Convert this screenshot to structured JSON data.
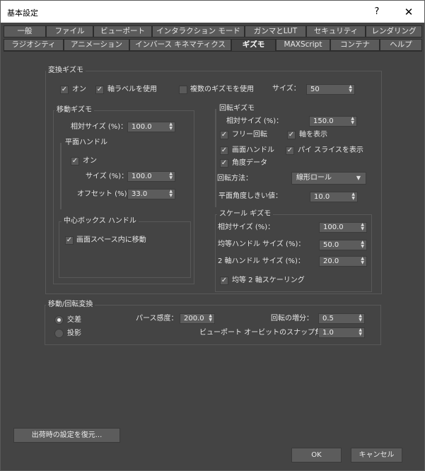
{
  "window": {
    "title": "基本設定",
    "help": "?",
    "close": "✕"
  },
  "tabs_row1": [
    "一般",
    "ファイル",
    "ビューポート",
    "インタラクション モード",
    "ガンマとLUT",
    "セキュリティ",
    "レンダリング"
  ],
  "tabs_row2": [
    "ラジオシティ",
    "アニメーション",
    "インバース キネマティクス",
    "ギズモ",
    "MAXScript",
    "コンテナ",
    "ヘルプ"
  ],
  "active_tab": "ギズモ",
  "transform_gizmo": {
    "title": "変換ギズモ",
    "on_label": "オン",
    "on_checked": true,
    "axis_labels_label": "軸ラベルを使用",
    "axis_labels_checked": true,
    "multiple_gizmos_label": "複数のギズモを使用",
    "multiple_gizmos_checked": false,
    "size_label": "サイズ：",
    "size_value": "50"
  },
  "move_gizmo": {
    "title": "移動ギズモ",
    "relative_size_label": "相対サイズ (%)：",
    "relative_size_value": "100.0",
    "plane_handle": {
      "title": "平面ハンドル",
      "on_label": "オン",
      "on_checked": true,
      "size_label": "サイズ (%)：",
      "size_value": "100.0",
      "offset_label": "オフセット (%)：",
      "offset_value": "33.0"
    },
    "center_box": {
      "title": "中心ボックス ハンドル",
      "move_in_screen_label": "画面スペース内に移動",
      "move_in_screen_checked": true
    }
  },
  "rotate_gizmo": {
    "title": "回転ギズモ",
    "relative_size_label": "相対サイズ (%)：",
    "relative_size_value": "150.0",
    "free_rotate_label": "フリー回転",
    "free_rotate_checked": true,
    "show_axis_label": "軸を表示",
    "show_axis_checked": true,
    "screen_handle_label": "画面ハンドル",
    "screen_handle_checked": true,
    "show_pie_label": "パイ スライスを表示",
    "show_pie_checked": true,
    "angle_data_label": "角度データ",
    "angle_data_checked": true,
    "rotation_method_label": "回転方法：",
    "rotation_method_value": "線形ロール",
    "plane_angle_label": "平面角度しきい値：",
    "plane_angle_value": "10.0"
  },
  "scale_gizmo": {
    "title": "スケール ギズモ",
    "relative_size_label": "相対サイズ (%)：",
    "relative_size_value": "100.0",
    "uniform_handle_label": "均等ハンドル サイズ (%)：",
    "uniform_handle_value": "50.0",
    "two_axis_handle_label": "2 軸ハンドル サイズ (%)：",
    "two_axis_handle_value": "20.0",
    "uniform_2axis_label": "均等 2 軸スケーリング",
    "uniform_2axis_checked": true
  },
  "move_rotate": {
    "title": "移動/回転変換",
    "ortho_label": "交差",
    "ortho_selected": true,
    "projection_label": "投影",
    "projection_selected": false,
    "perspective_label": "パース感度：",
    "perspective_value": "200.0",
    "rotation_increment_label": "回転の増分：",
    "rotation_increment_value": "0.5",
    "orbit_snap_label": "ビューポート オービットのスナップ角度：",
    "orbit_snap_value": "1.0"
  },
  "buttons": {
    "restore": "出荷時の設定を復元...",
    "ok": "OK",
    "cancel": "キャンセル"
  }
}
